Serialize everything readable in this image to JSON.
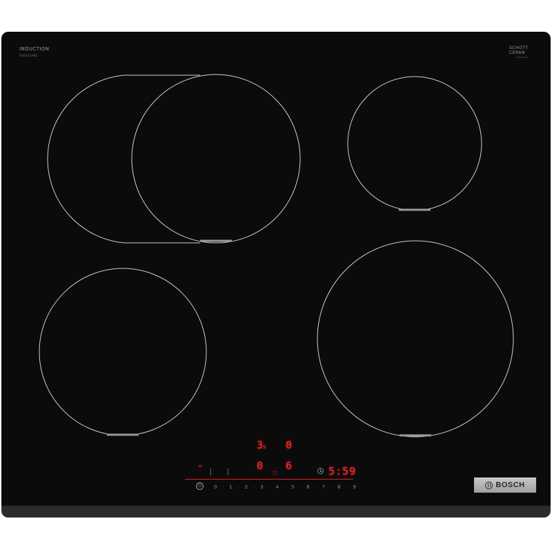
{
  "branding": {
    "product_label": "INDUCTION",
    "product_sub": "PXE631HB1",
    "glass_brand_line1": "SCHOTT",
    "glass_brand_line2": "CERAN",
    "glass_brand_sub": "SOLARIS",
    "manufacturer": "BOSCH"
  },
  "control_panel": {
    "zone_display_top_left": "3",
    "zone_display_top_left_sub": "5",
    "zone_display_top_right": "0",
    "zone_display_bottom_left": "0",
    "zone_display_bottom_right": "6",
    "timer_display": "5:59",
    "power_scale": [
      "0",
      "1",
      "2",
      "3",
      "4",
      "5",
      "6",
      "7",
      "8",
      "9"
    ],
    "icons": [
      "wifi-icon",
      "favourite-star-icon",
      "timer-clock-icon",
      "power-icon"
    ]
  },
  "colors": {
    "glass": "#0b0b0c",
    "display_red": "#ff2a2a",
    "zone_outline": "#cfcfcf"
  }
}
